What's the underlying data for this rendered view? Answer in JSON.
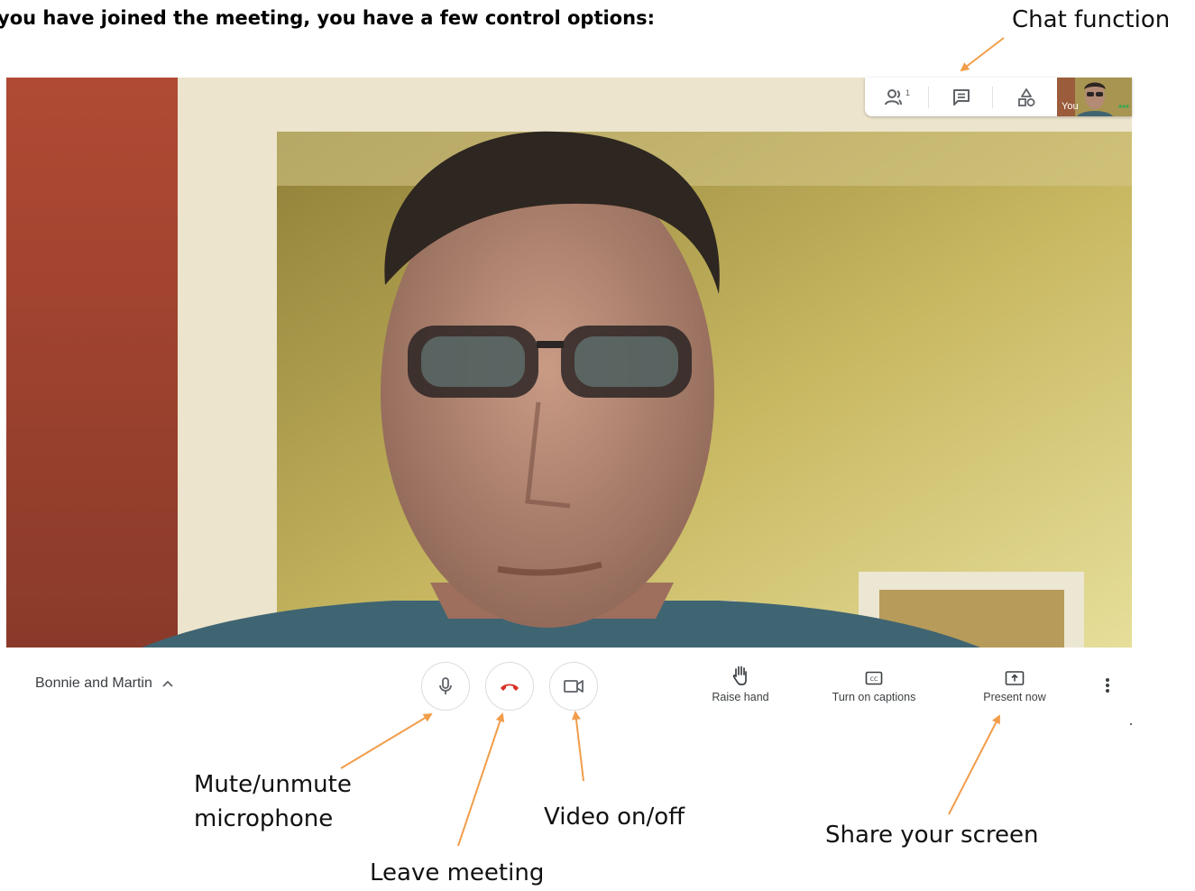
{
  "heading": "you have joined the meeting, you have a few control options:",
  "annotations": {
    "chat_function": "Chat function",
    "mute_line1": "Mute/unmute",
    "mute_line2": "microphone",
    "leave_meeting": "Leave meeting",
    "video_toggle": "Video on/off",
    "share_screen": "Share your screen"
  },
  "top_panel": {
    "participants_count": "1",
    "icons": [
      "people-icon",
      "chat-icon",
      "activities-icon"
    ],
    "self_view_label": "You"
  },
  "bottom_bar": {
    "meeting_name": "Bonnie and Martin",
    "controls": [
      {
        "name": "microphone-button",
        "icon": "microphone-icon"
      },
      {
        "name": "leave-call-button",
        "icon": "hang-up-icon"
      },
      {
        "name": "camera-button",
        "icon": "video-camera-icon"
      }
    ],
    "tools": [
      {
        "label": "Raise hand",
        "icon": "hand-icon"
      },
      {
        "label": "Turn on captions",
        "icon": "captions-icon"
      },
      {
        "label": "Present now",
        "icon": "present-icon"
      }
    ]
  },
  "colors": {
    "annotation_arrow": "#f29d4b",
    "hang_up_red": "#d93025",
    "icon_gray": "#5f6368",
    "wall_red": "#b3513a",
    "door_frame": "#ece4cc",
    "wall_yellow": "#b8a44a"
  }
}
